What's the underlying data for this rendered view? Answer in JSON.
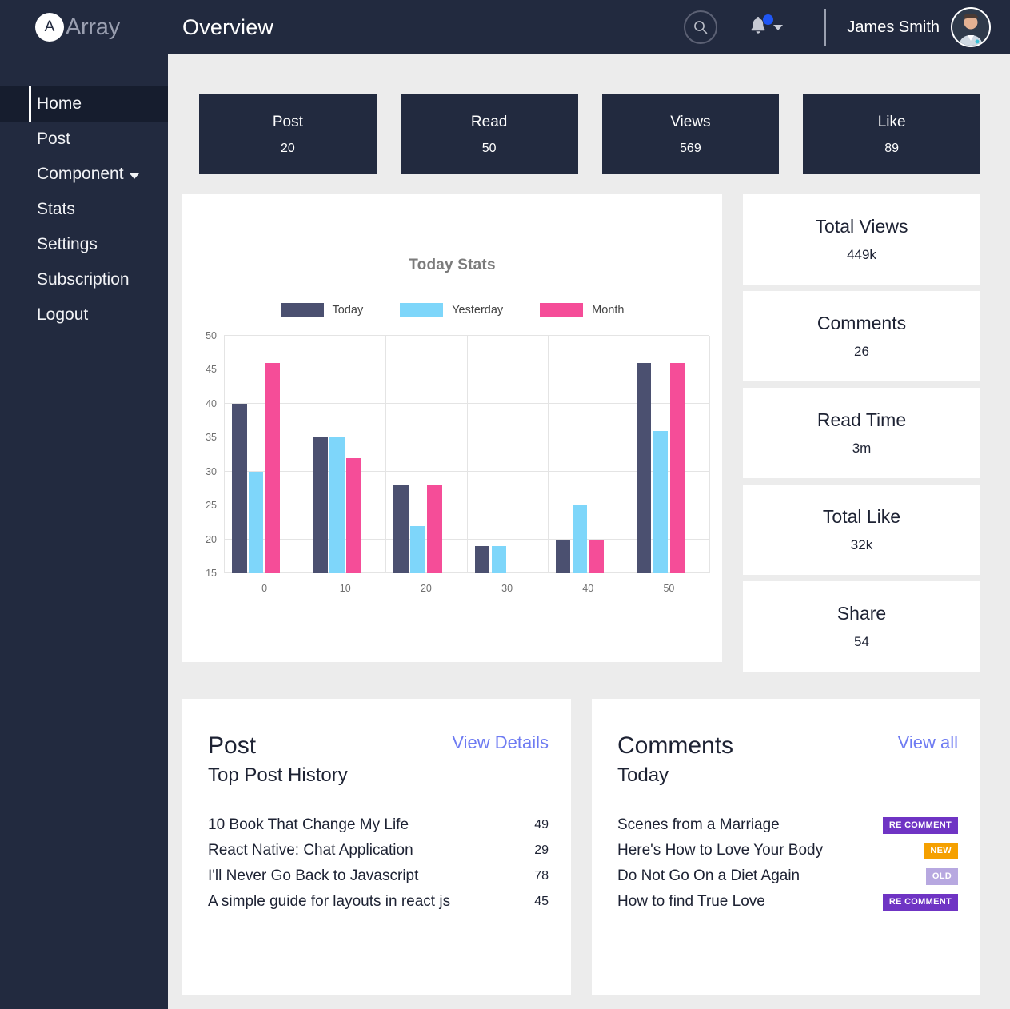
{
  "header": {
    "brand_initial": "A",
    "brand_name": "Array",
    "page_title": "Overview",
    "search_icon": "search-icon",
    "bell_icon": "bell-icon",
    "user_name": "James Smith",
    "avatar": "user-avatar"
  },
  "sidebar": {
    "items": [
      {
        "label": "Home",
        "active": true,
        "caret": false
      },
      {
        "label": "Post",
        "active": false,
        "caret": false
      },
      {
        "label": "Component",
        "active": false,
        "caret": true
      },
      {
        "label": "Stats",
        "active": false,
        "caret": false
      },
      {
        "label": "Settings",
        "active": false,
        "caret": false
      },
      {
        "label": "Subscription",
        "active": false,
        "caret": false
      },
      {
        "label": "Logout",
        "active": false,
        "caret": false
      }
    ]
  },
  "kpis": [
    {
      "label": "Post",
      "value": "20"
    },
    {
      "label": "Read",
      "value": "50"
    },
    {
      "label": "Views",
      "value": "569"
    },
    {
      "label": "Like",
      "value": "89"
    }
  ],
  "side_stats": [
    {
      "label": "Total Views",
      "value": "449k"
    },
    {
      "label": "Comments",
      "value": "26"
    },
    {
      "label": "Read Time",
      "value": "3m"
    },
    {
      "label": "Total Like",
      "value": "32k"
    },
    {
      "label": "Share",
      "value": "54"
    }
  ],
  "post_panel": {
    "title": "Post",
    "link": "View Details",
    "subtitle": "Top Post History",
    "rows": [
      {
        "label": "10 Book That Change My Life",
        "value": "49"
      },
      {
        "label": "React Native: Chat Application",
        "value": "29"
      },
      {
        "label": "I'll Never Go Back to Javascript",
        "value": "78"
      },
      {
        "label": "A simple guide for layouts in react js",
        "value": "45"
      }
    ]
  },
  "comments_panel": {
    "title": "Comments",
    "link": "View all",
    "subtitle": "Today",
    "rows": [
      {
        "label": "Scenes from a Marriage",
        "badge": "RE COMMENT",
        "badge_color": "#6f34c4"
      },
      {
        "label": "Here's How to Love Your Body",
        "badge": "NEW",
        "badge_color": "#f5a000"
      },
      {
        "label": "Do Not Go On a Diet Again",
        "badge": "OLD",
        "badge_color": "#b7a8e0"
      },
      {
        "label": "How to find True Love",
        "badge": "RE COMMENT",
        "badge_color": "#6f34c4"
      }
    ]
  },
  "chart_data": {
    "type": "bar",
    "title": "Today Stats",
    "xlabel": "",
    "ylabel": "",
    "categories": [
      "0",
      "10",
      "20",
      "30",
      "40",
      "50"
    ],
    "series": [
      {
        "name": "Today",
        "color": "#4b5070",
        "values": [
          40,
          35,
          28,
          19,
          20,
          46
        ]
      },
      {
        "name": "Yesterday",
        "color": "#7ed6fa",
        "values": [
          30,
          35,
          22,
          19,
          25,
          36
        ]
      },
      {
        "name": "Month",
        "color": "#f54d98",
        "values": [
          46,
          32,
          28,
          0,
          20,
          46
        ]
      }
    ],
    "ylim": [
      15,
      50
    ],
    "yticks": [
      15,
      20,
      25,
      30,
      35,
      40,
      45,
      50
    ],
    "grid": true,
    "legend_position": "top"
  },
  "colors": {
    "sidebar_bg": "#222a3f",
    "content_bg": "#ececec",
    "accent_link": "#6e7bf2",
    "notification_dot": "#1f56f5"
  }
}
